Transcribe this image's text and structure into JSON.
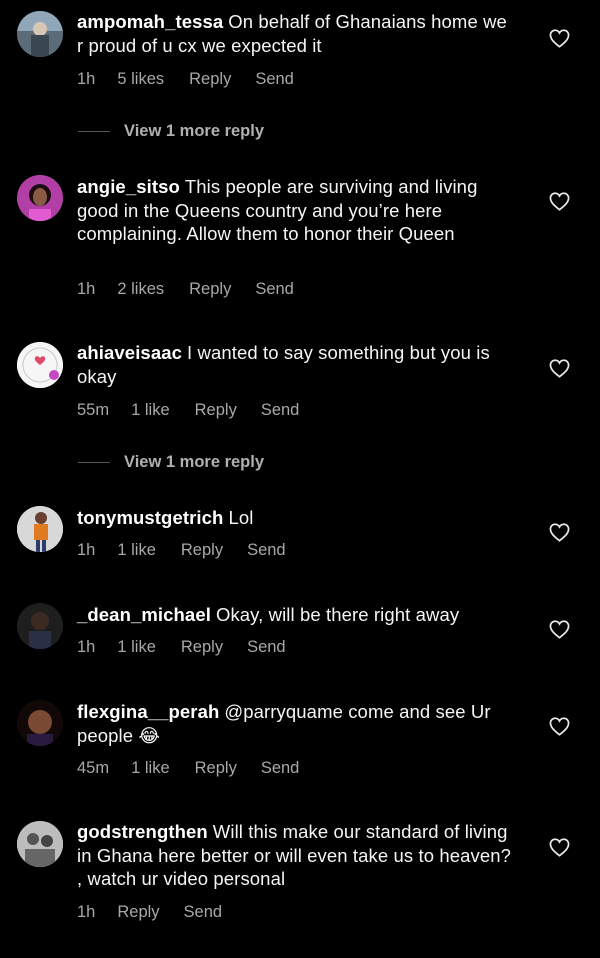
{
  "comments": [
    {
      "username": "ampomah_tessa",
      "text": "On behalf of Ghanaians home we r proud of u cx we expected it",
      "time": "1h",
      "likes": "5 likes",
      "reply": "Reply",
      "send": "Send"
    },
    {
      "username": "angie_sitso",
      "text": "This people are surviving and living good in the Queens country and you’re here complaining. Allow them to honor their Queen",
      "time": "1h",
      "likes": "2 likes",
      "reply": "Reply",
      "send": "Send"
    },
    {
      "username": "ahiaveisaac",
      "text": "I wanted to say something but you is okay",
      "time": "55m",
      "likes": "1 like",
      "reply": "Reply",
      "send": "Send"
    },
    {
      "username": "tonymustgetrich",
      "text": "Lol",
      "time": "1h",
      "likes": "1 like",
      "reply": "Reply",
      "send": "Send"
    },
    {
      "username": "_dean_michael",
      "text": "Okay, will be there right away",
      "time": "1h",
      "likes": "1 like",
      "reply": "Reply",
      "send": "Send"
    },
    {
      "username": "flexgina__perah",
      "text": "@parryquame come and see Ur people 😂",
      "time": "45m",
      "likes": "1 like",
      "reply": "Reply",
      "send": "Send"
    },
    {
      "username": "godstrengthen",
      "text": "Will this make our standard of living in Ghana here better or will even take us to heaven? , watch ur video personal",
      "time": "1h",
      "reply": "Reply",
      "send": "Send"
    }
  ],
  "view_more": [
    {
      "label": "View 1 more reply"
    },
    {
      "label": "View 1 more reply"
    }
  ],
  "colors": {
    "background": "#000000",
    "text": "#f5f5f5",
    "meta": "#a8a8a8"
  },
  "icons": {
    "like": "heart-outline-icon"
  }
}
